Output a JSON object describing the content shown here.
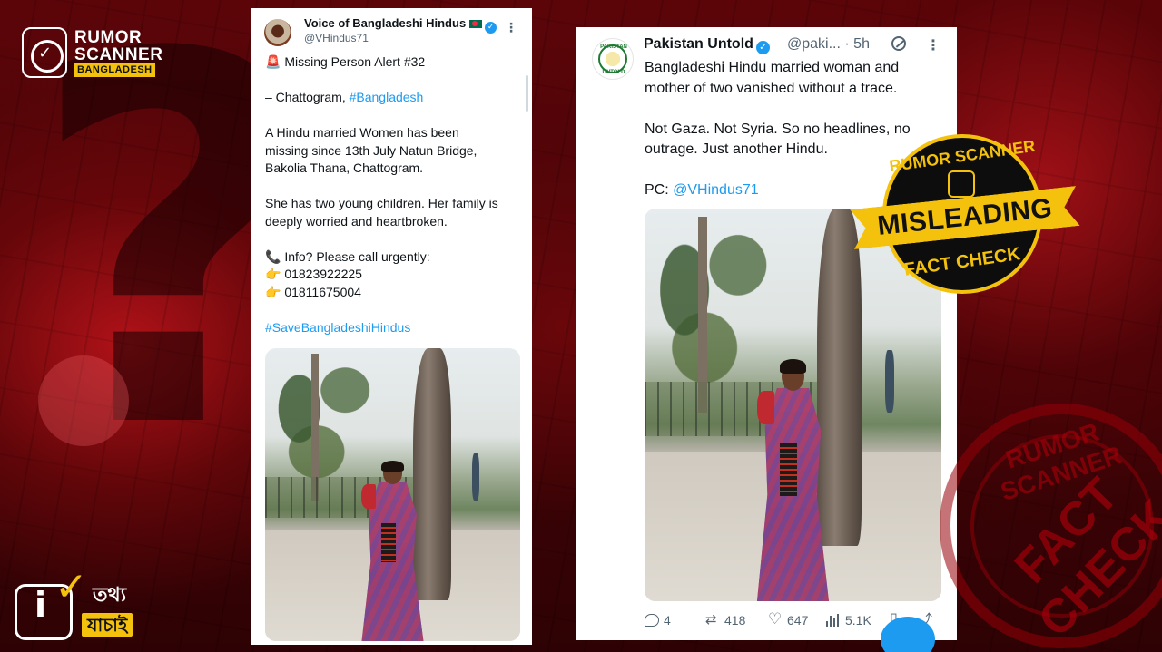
{
  "brand": {
    "line1": "RUMOR",
    "line2": "SCANNER",
    "line3": "BANGLADESH"
  },
  "footer_logo": {
    "icon": "i",
    "line1": "তথ্য",
    "line2": "যাচাই"
  },
  "stamp": {
    "top": "RUMOR SCANNER",
    "verdict": "MISLEADING",
    "bottom": "FACT CHECK",
    "color_ribbon": "#f4c20d"
  },
  "stamp_background": {
    "top": "RUMOR SCANNER",
    "main": "FACT CHECK"
  },
  "left_tweet": {
    "name": "Voice of Bangladeshi Hindus",
    "handle": "@VHindus71",
    "lines": [
      "🚨 Missing Person Alert #32",
      "",
      "– Chattogram, #Bangladesh",
      "",
      "A Hindu married Women  has been",
      "missing since 13th July  Natun Bridge,",
      "Bakolia Thana, Chattogram.",
      "",
      "She has two young children. Her family is",
      "deeply worried and heartbroken.",
      "",
      "📞 Info? Please call urgently:",
      "👉 01823922225",
      "👉 01811675004",
      "",
      "#SaveBangladeshiHindus"
    ],
    "link_words": {
      "location_tag": "#Bangladesh",
      "hashtag": "#SaveBangladeshiHindus"
    }
  },
  "right_tweet": {
    "name": "Pakistan Untold",
    "handle": "@paki...",
    "time": "· 5h",
    "avatar_text_top": "PAKISTAN",
    "avatar_text_bottom": "UNTOLD",
    "lines": [
      "Bangladeshi Hindu married woman and",
      "mother of two vanished without a trace.",
      "",
      "Not Gaza. Not Syria. So no headlines, no",
      "outrage. Just another Hindu.",
      "",
      "PC: "
    ],
    "mention": "@VHindus71",
    "stats": {
      "replies": "4",
      "retweets": "418",
      "likes": "647",
      "views": "5.1K"
    }
  },
  "colors": {
    "link": "#1d9bf0",
    "verified": "#1d9bf0",
    "background_red": "#9e1016"
  }
}
